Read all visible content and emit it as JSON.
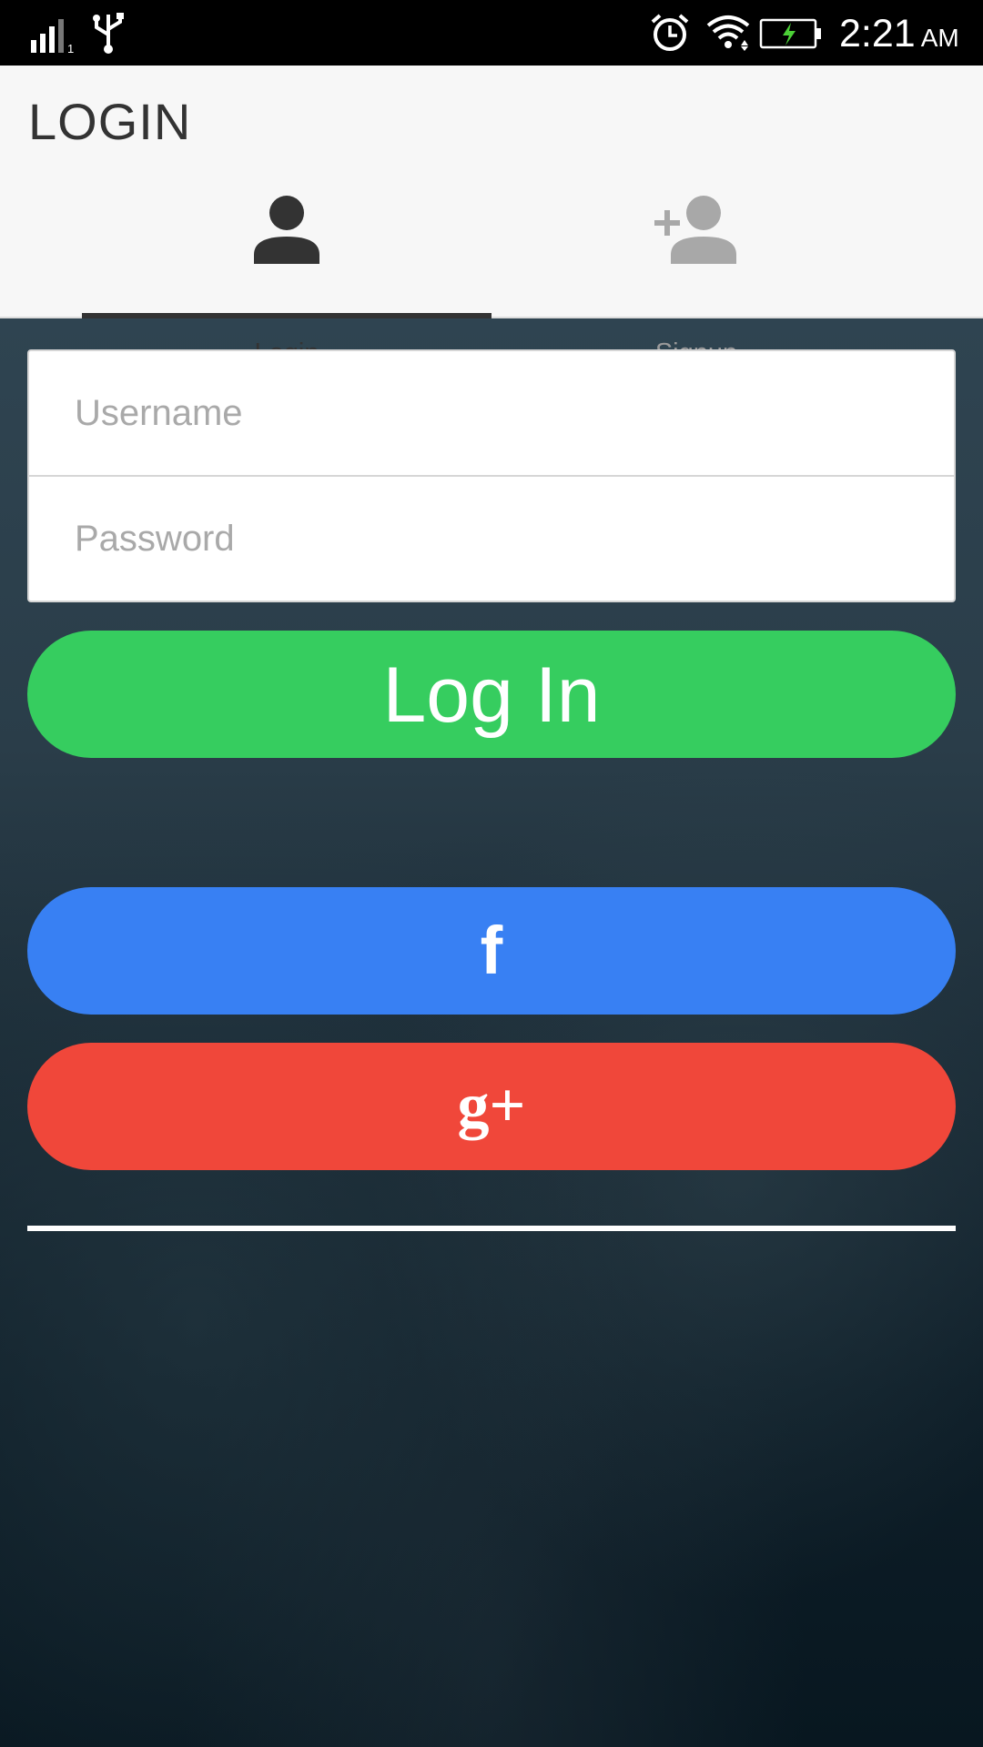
{
  "status_bar": {
    "time": "2:21",
    "ampm": "AM",
    "icons": [
      "signal-icon",
      "usb-icon",
      "alarm-icon",
      "wifi-icon",
      "battery-charging-icon"
    ]
  },
  "header": {
    "title": "LOGIN"
  },
  "tabs": [
    {
      "label": "Login",
      "icon": "person-icon",
      "selected": true
    },
    {
      "label": "Signup",
      "icon": "add-person-icon",
      "selected": false
    }
  ],
  "form": {
    "username_placeholder": "Username",
    "username_value": "",
    "password_placeholder": "Password",
    "password_value": ""
  },
  "buttons": {
    "login_label": "Log In",
    "facebook_label": "f",
    "google_label": "g+"
  },
  "colors": {
    "login_button": "#36cd5f",
    "facebook_button": "#3880f3",
    "google_button": "#f0473a",
    "header_background": "#f7f7f7",
    "tab_indicator": "#333333"
  }
}
